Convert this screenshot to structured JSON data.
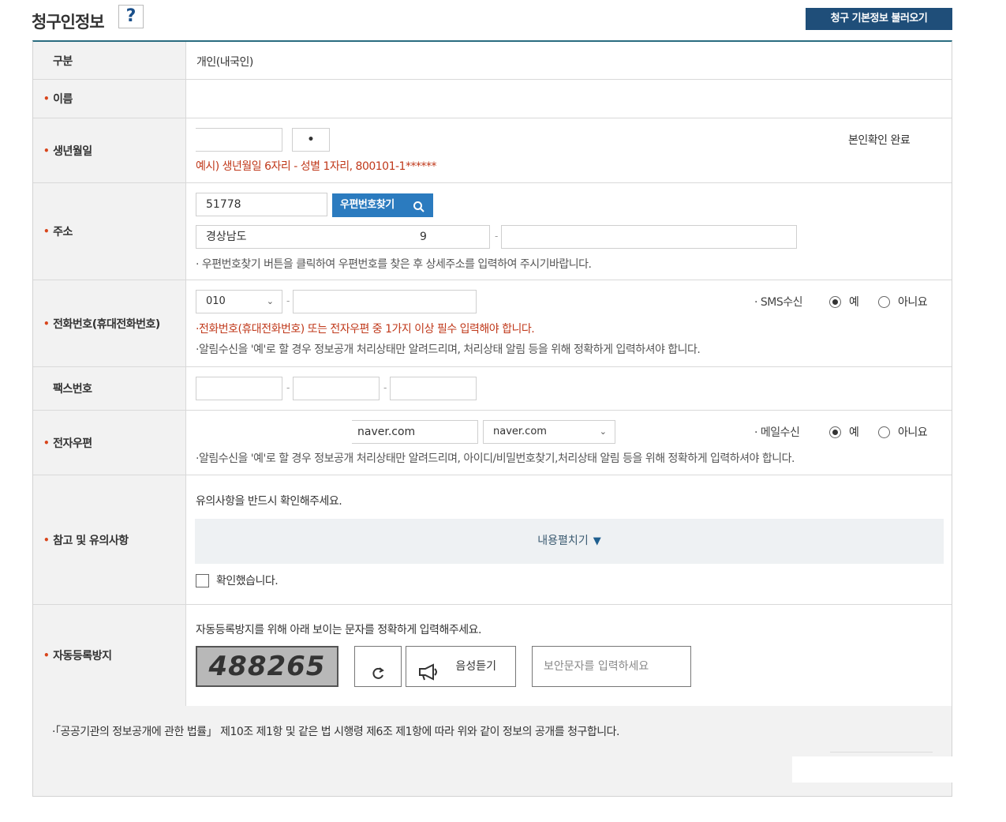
{
  "header": {
    "title": "청구인정보",
    "help_label": "?",
    "load_button": "청구 기본정보 불러오기"
  },
  "rows": {
    "category": {
      "label": "구분",
      "value": "개인(내국인)"
    },
    "name": {
      "label": "이름",
      "required_mark": "•"
    },
    "birth": {
      "label": "생년월일",
      "required_mark": "•",
      "second_value": "•",
      "verified": "본인확인 완료",
      "example": "예시) 생년월일 6자리 - 성별 1자리, 800101-1******"
    },
    "address": {
      "label": "주소",
      "required_mark": "•",
      "zipcode": "51778",
      "find_button": "우편번호찾기",
      "addr1": "경상남도",
      "addr1_suffix": "9",
      "hint": "· 우편번호찾기 버튼을 클릭하여 우편번호를 찾은 후 상세주소를 입력하여 주시기바랍니다."
    },
    "phone": {
      "label": "전화번호(휴대전화번호)",
      "required_mark": "•",
      "prefix": "010",
      "sms_label": "· SMS수신",
      "yes": "예",
      "no": "아니요",
      "notice_red": "·전화번호(휴대전화번호) 또는 전자우편 중 1가지 이상 필수 입력해야 합니다.",
      "notice": "·알림수신을 '예'로 할 경우 정보공개 처리상태만 알려드리며, 처리상태 알림 등을 위해 정확하게 입력하셔야 합니다."
    },
    "fax": {
      "label": "팩스번호"
    },
    "email": {
      "label": "전자우편",
      "required_mark": "•",
      "domain": "naver.com",
      "domain_select": "naver.com",
      "mail_label": "· 메일수신",
      "yes": "예",
      "no": "아니요",
      "notice": "·알림수신을 '예'로 할 경우 정보공개 처리상태만 알려드리며, 아이디/비밀번호찾기,처리상태 알림 등을 위해 정확하게 입력하셔야 합니다."
    },
    "notes": {
      "label": "참고 및 유의사항",
      "required_mark": "•",
      "intro": "유의사항을 반드시 확인해주세요.",
      "expand_label": "내용펼치기",
      "expand_arrow": "▼",
      "confirm_label": "확인했습니다."
    },
    "captcha": {
      "label": "자동등록방지",
      "required_mark": "•",
      "intro": "자동등록방지를 위해 아래 보이는 문자를 정확하게 입력해주세요.",
      "code": "488265",
      "audio_label": "음성듣기",
      "input_placeholder": "보안문자를 입력하세요"
    }
  },
  "footer": {
    "statement": "·「공공기관의 정보공개에 관한 법률」 제10조 제1항 및 같은 법 시행령 제6조 제1항에 따라 위와 같이 정보의 공개를 청구합니다."
  }
}
